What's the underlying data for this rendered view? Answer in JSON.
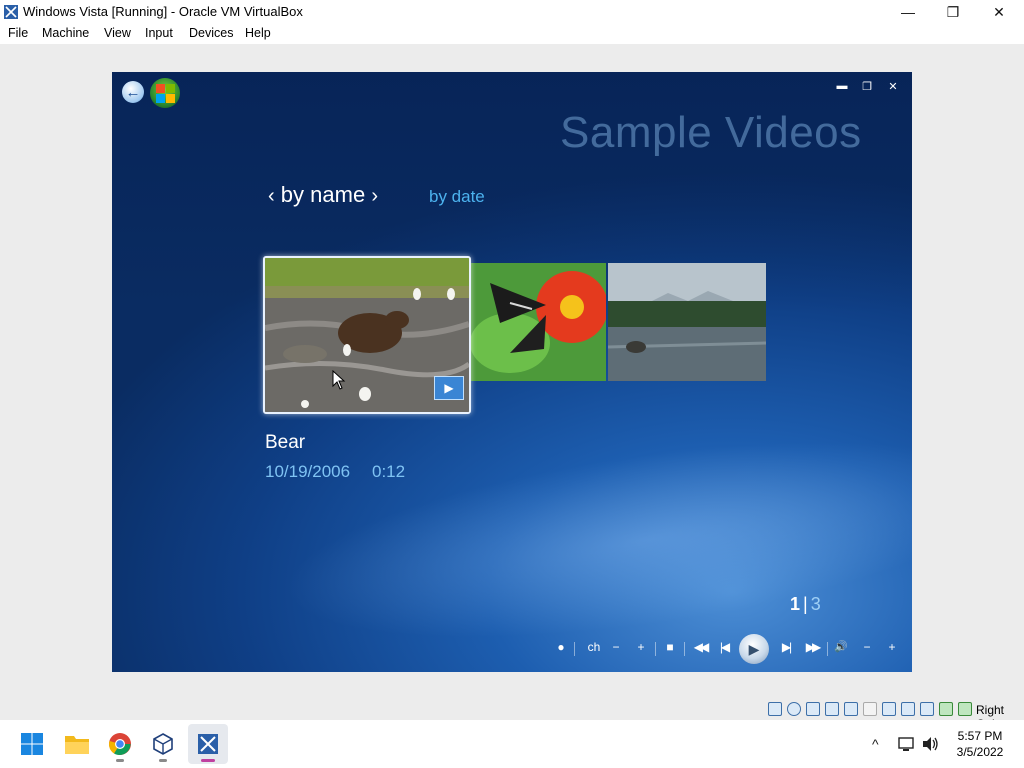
{
  "window": {
    "title": "Windows Vista [Running] - Oracle VM VirtualBox",
    "min_glyph": "—",
    "max_glyph": "❐",
    "close_glyph": "✕"
  },
  "menu": [
    "File",
    "Machine",
    "View",
    "Input",
    "Devices",
    "Help"
  ],
  "media_center": {
    "page_title": "Sample Videos",
    "sort_active": "by name",
    "sort_prev_glyph": "‹",
    "sort_next_glyph": "›",
    "sort_other": "by date",
    "selected_item": {
      "name": "Bear",
      "date": "10/19/2006",
      "duration": "0:12"
    },
    "thumbnails": [
      "bear",
      "butterfly",
      "lake"
    ],
    "pager": {
      "current": "1",
      "separator": "|",
      "total": "3"
    },
    "transport": {
      "record": "●",
      "ch": "ch",
      "ch_down": "−",
      "ch_up": "+",
      "stop": "■",
      "rewind": "◀◀",
      "prev": "|◀",
      "play": "▶",
      "next": "▶|",
      "fast_forward": "▶▶",
      "mute": "🔊",
      "vol_down": "−",
      "vol_up": "+"
    }
  },
  "statusbar": {
    "host_key": "Right Ctrl",
    "icons": [
      "hard-disk",
      "optical-drive",
      "audio",
      "network",
      "usb",
      "shared-folders",
      "display",
      "recording",
      "cpu",
      "guest-additions",
      "mouse-integration"
    ]
  },
  "taskbar": {
    "apps": [
      "start",
      "file-explorer",
      "chrome",
      "virtualbox",
      "vm-vista"
    ],
    "clock_time": "5:57 PM",
    "clock_date": "3/5/2022",
    "tray_chevron": "^"
  },
  "colors": {
    "vm_background": "#1d5eb0",
    "accent_text": "#7fc3f3",
    "sort_other": "#4cb2ee"
  }
}
